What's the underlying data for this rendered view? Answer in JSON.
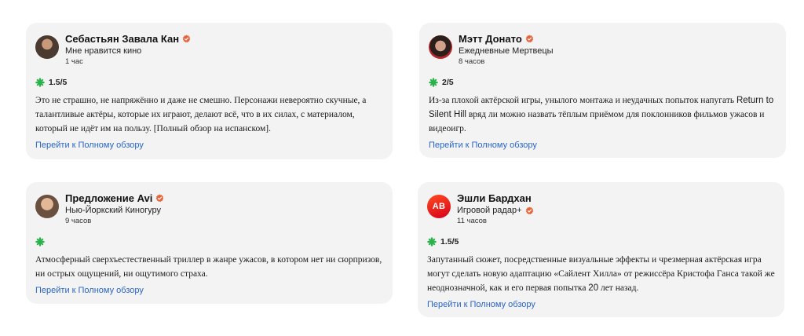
{
  "reviews": [
    {
      "critic_name": "Себастьян Завала Кан",
      "publication": "Мне нравится кино",
      "time_ago": "1 час",
      "score": "1.5/5",
      "text": "Это не страшно, не напряжённо и даже не смешно. Персонажи невероятно скучные, а талантливые актёры, которые их играют, делают всё, что в их силах, с материалом, который не идёт им на пользу. [Полный обзор на испанском].",
      "link_label": "Перейти к Полному обзору",
      "avatar": "critic-photo",
      "verified_icon": "verified-check-icon",
      "rating_icon": "splat-icon"
    },
    {
      "critic_name": "Мэтт Донато",
      "publication": "Ежедневные Мертвецы",
      "time_ago": "8 часов",
      "score": "2/5",
      "text_before": "Из-за плохой актёрской игры, унылого монтажа и неудачных попыток напугать ",
      "text_title": "Return to Silent Hill",
      "text_after": " вряд ли можно назвать тёплым приёмом для поклонников фильмов ужасов и видеоигр.",
      "link_label": "Перейти к Полному обзору",
      "avatar": "critic-photo",
      "verified_icon": "verified-check-icon",
      "rating_icon": "splat-icon"
    },
    {
      "critic_name": "Предложение Avi",
      "publication": "Нью-Йоркский Киногуру",
      "time_ago": "9 часов",
      "score": "",
      "text": "Атмосферный сверхъестественный триллер в жанре ужасов, в котором нет ни сюрпризов, ни острых ощущений, ни ощутимого страха.",
      "link_label": "Перейти к Полному обзору",
      "avatar": "critic-photo",
      "verified_icon": "verified-check-icon",
      "rating_icon": "splat-icon"
    },
    {
      "critic_name": "Эшли Бардхан",
      "publication": "Игровой радар+",
      "time_ago": "11 часов",
      "score": "1.5/5",
      "avatar_initials": "AB",
      "text_before": "Запутанный сюжет, посредственные визуальные эффекты и чрезмерная актёрская игра могут сделать новую адаптацию «Сайлент Хилла» от режиссёра Кристофа Ганса такой же неоднозначной, как и его первая попытка ",
      "text_num": "20",
      "text_after": " лет назад.",
      "link_label": "Перейти к Полному обзору",
      "avatar": "initials-avatar",
      "verified_icon": "verified-check-icon",
      "rating_icon": "splat-icon"
    }
  ],
  "colors": {
    "card_bg": "#f3f3f3",
    "verified": "#e8643a",
    "splat": "#2bb24c",
    "link": "#2a66c8",
    "initials_avatar": "#e8201c"
  }
}
